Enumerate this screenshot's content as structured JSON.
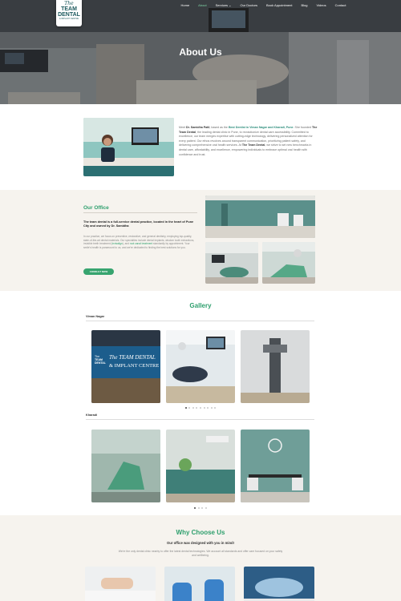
{
  "header": {
    "logo": {
      "line1": "The",
      "line2": "TEAM",
      "line3": "DENTAL",
      "line4": "& IMPLANT CENTRE"
    },
    "nav": [
      {
        "label": "Home"
      },
      {
        "label": "About"
      },
      {
        "label": "Services",
        "dropdown": true
      },
      {
        "label": "Our Doctors"
      },
      {
        "label": "Book Appointment"
      },
      {
        "label": "Blog"
      },
      {
        "label": "Videos"
      },
      {
        "label": "Contact"
      }
    ],
    "active_nav": "About",
    "nav_chevron": "chevron-down-icon"
  },
  "hero": {
    "title": "About Us"
  },
  "intro": {
    "t1": "Meet ",
    "name": "Dr. Samidha Patil",
    "t2": ", based as the ",
    "best": "Best Dentist in Viman Nagar and Kharadi, Pune",
    "t3": ". She founded ",
    "brand": "The Team Dental",
    "t4": ", the leading dental clinic in Pune, to revolutionize dental care accessibility. Committed to excellence, our team merges expertise with cutting-edge technology, delivering personalized attention for every patient. Our ethos revolves around transparent communication, prioritizing patient safety, and delivering comprehensive oral health services. At ",
    "brand2": "The Team Dental",
    "t5": ", we strive to set new benchmarks in dental care, affordability, and excellence, empowering individuals to embrace optimal oral health with confidence and trust."
  },
  "office": {
    "title": "Our Office",
    "lead": "The team dental is a full-service dental practice, located in the heart of Pune City and owned by Dr. Samidha",
    "b1": "In our practice, we focus on preventive, restorative, and general dentistry, employing top-quality, state-of-the-art dental materials. Our specialties include dental implants, wisdom tooth extractions, invisible teeth treatment (",
    "hl1": "invisalign",
    "b2": "), and ",
    "hl2": "root canal treatment",
    "b3": " standardly by appointment. Your smile's health is paramount to us, and we're dedicated to finding the best solutions for you.",
    "button": "CONSULT NOW"
  },
  "gallery": {
    "title": "Gallery",
    "sections": [
      {
        "name": "Viman Nagar",
        "dot_count": 9,
        "active_dot": 0
      },
      {
        "name": "Kharadi",
        "dot_count": 4,
        "active_dot": 0
      }
    ],
    "sign_line1": "The TEAM DENTAL",
    "sign_line2": "& IMPLANT CENTRE",
    "sign_small1": "The",
    "sign_small2": "TEAM",
    "sign_small3": "DENTAL"
  },
  "why": {
    "title": "Why Choose Us",
    "tagline": "Our office was designed with you in mind!",
    "desc": "We're the only dental clinic nearby to offer the latest dental technologies. We account all standards and offer care focused on your safety and wellbeing."
  },
  "colors": {
    "accent_green": "#2e9f6d",
    "button_green": "#37a46f",
    "teal_wall": "#4f8a86",
    "beige_bg": "#f6f3ee"
  }
}
